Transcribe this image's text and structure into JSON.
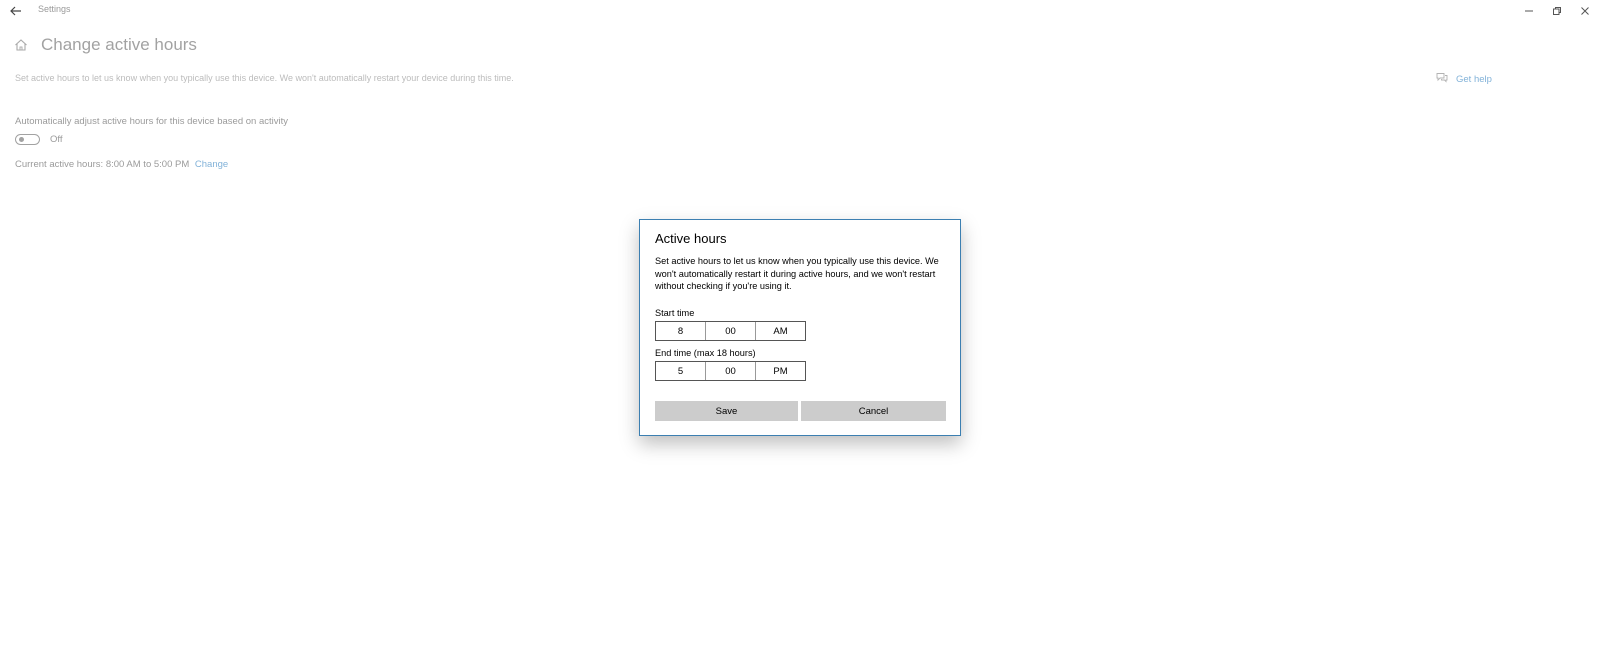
{
  "window": {
    "title": "Settings",
    "back_icon": "back-arrow-icon",
    "minimize_icon": "minimize-icon",
    "restore_icon": "restore-icon",
    "close_icon": "close-icon"
  },
  "page": {
    "home_icon": "home-icon",
    "title": "Change active hours",
    "description": "Set active hours to let us know when you typically use this device. We won't automatically restart your device during this time.",
    "get_help_label": "Get help",
    "help_icon": "help-chat-icon",
    "auto_adjust_label": "Automatically adjust active hours for this device based on activity",
    "auto_adjust_state": "Off",
    "current_hours_text": "Current active hours: 8:00 AM to 5:00 PM",
    "change_link": "Change"
  },
  "dialog": {
    "title": "Active hours",
    "text": "Set active hours to let us know when you typically use this device. We won't automatically restart it during active hours, and we won't restart without checking if you're using it.",
    "start_label": "Start time",
    "start": {
      "hour": "8",
      "minute": "00",
      "period": "AM"
    },
    "end_label": "End time (max 18 hours)",
    "end": {
      "hour": "5",
      "minute": "00",
      "period": "PM"
    },
    "save_label": "Save",
    "cancel_label": "Cancel",
    "border_color": "#3c7fb1",
    "button_color": "#cccccc"
  },
  "colors": {
    "link": "#0063b1"
  }
}
